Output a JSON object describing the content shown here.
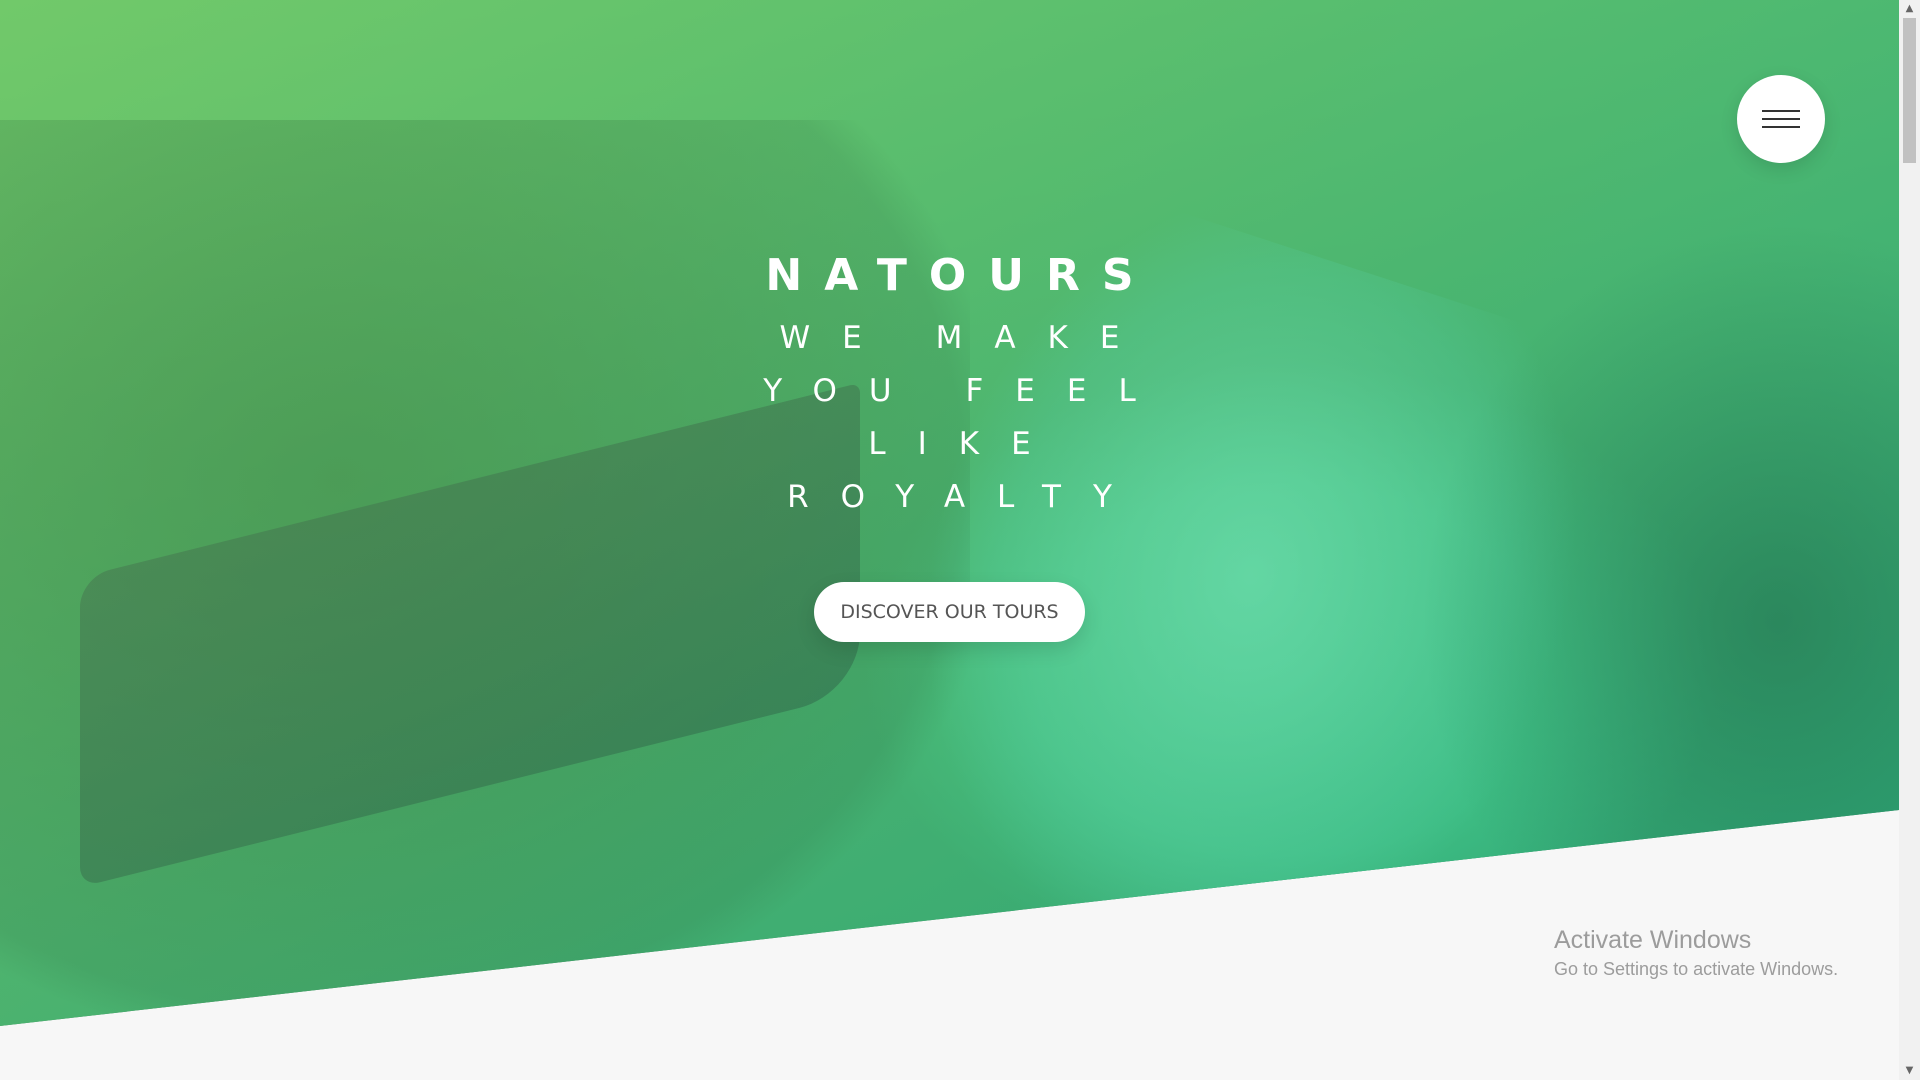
{
  "hero": {
    "brand": "NATOURS",
    "tagline": "WE MAKE YOU FEEL LIKE ROYALTY",
    "cta_label": "DISCOVER OUR TOURS"
  },
  "menu": {
    "icon": "hamburger-menu-icon"
  },
  "watermark": {
    "title": "Activate Windows",
    "subtitle": "Go to Settings to activate Windows."
  },
  "scrollbar": {
    "up_glyph": "▲",
    "down_glyph": "▼"
  },
  "colors": {
    "gradient_start": "#7ed56f",
    "gradient_end": "#28b485",
    "page_bg": "#f7f7f7"
  }
}
